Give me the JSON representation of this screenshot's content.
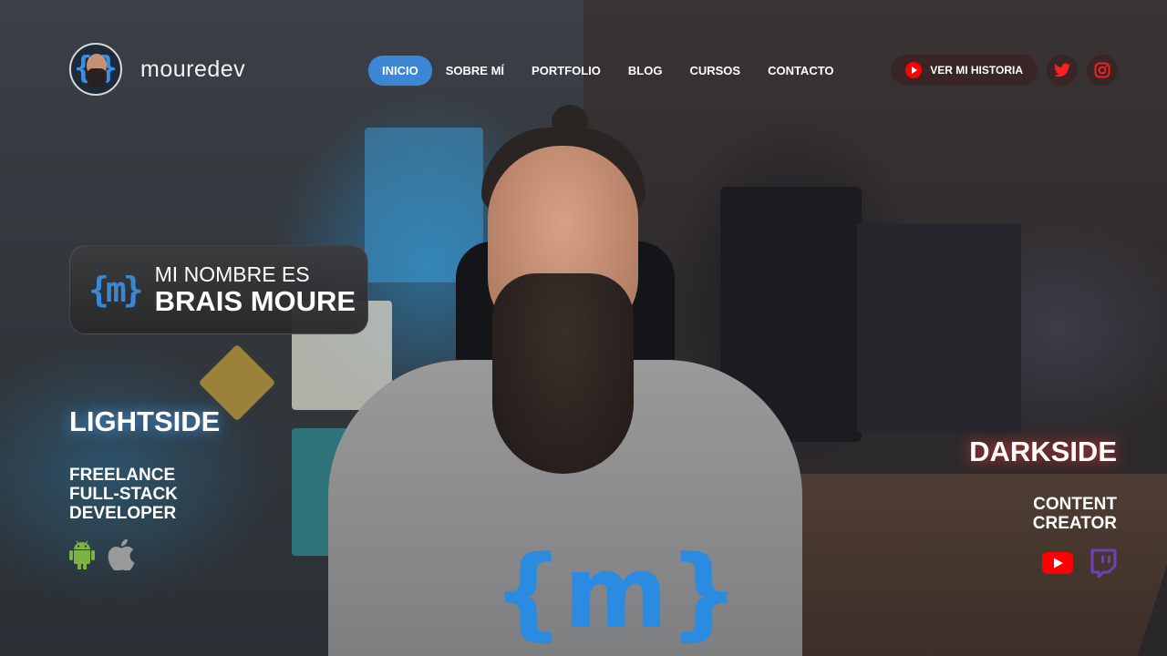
{
  "header": {
    "brand_name": "mouredev",
    "nav": [
      {
        "label": "INICIO",
        "active": true
      },
      {
        "label": "SOBRE MÍ",
        "active": false
      },
      {
        "label": "PORTFOLIO",
        "active": false
      },
      {
        "label": "BLOG",
        "active": false
      },
      {
        "label": "CURSOS",
        "active": false
      },
      {
        "label": "CONTACTO",
        "active": false
      }
    ],
    "history_button": "VER MI HISTORIA",
    "social": [
      "twitter-icon",
      "instagram-icon"
    ]
  },
  "hero": {
    "card_line1": "MI NOMBRE ES",
    "card_line2": "BRAIS MOURE",
    "card_logo": "{m}",
    "shirt_logo": "{m}"
  },
  "lightside": {
    "title": "LIGHTSIDE",
    "subtitle": [
      "FREELANCE",
      "FULL-STACK",
      "DEVELOPER"
    ],
    "icons": [
      "android-icon",
      "apple-icon"
    ]
  },
  "darkside": {
    "title": "DARKSIDE",
    "subtitle": [
      "CONTENT",
      "CREATOR"
    ],
    "icons": [
      "youtube-icon",
      "twitch-icon"
    ]
  },
  "colors": {
    "accent": "#3c86d6",
    "youtube": "#ff0000",
    "twitch": "#6e3fb8",
    "android": "#7cb342",
    "apple": "#9a9a9a"
  }
}
